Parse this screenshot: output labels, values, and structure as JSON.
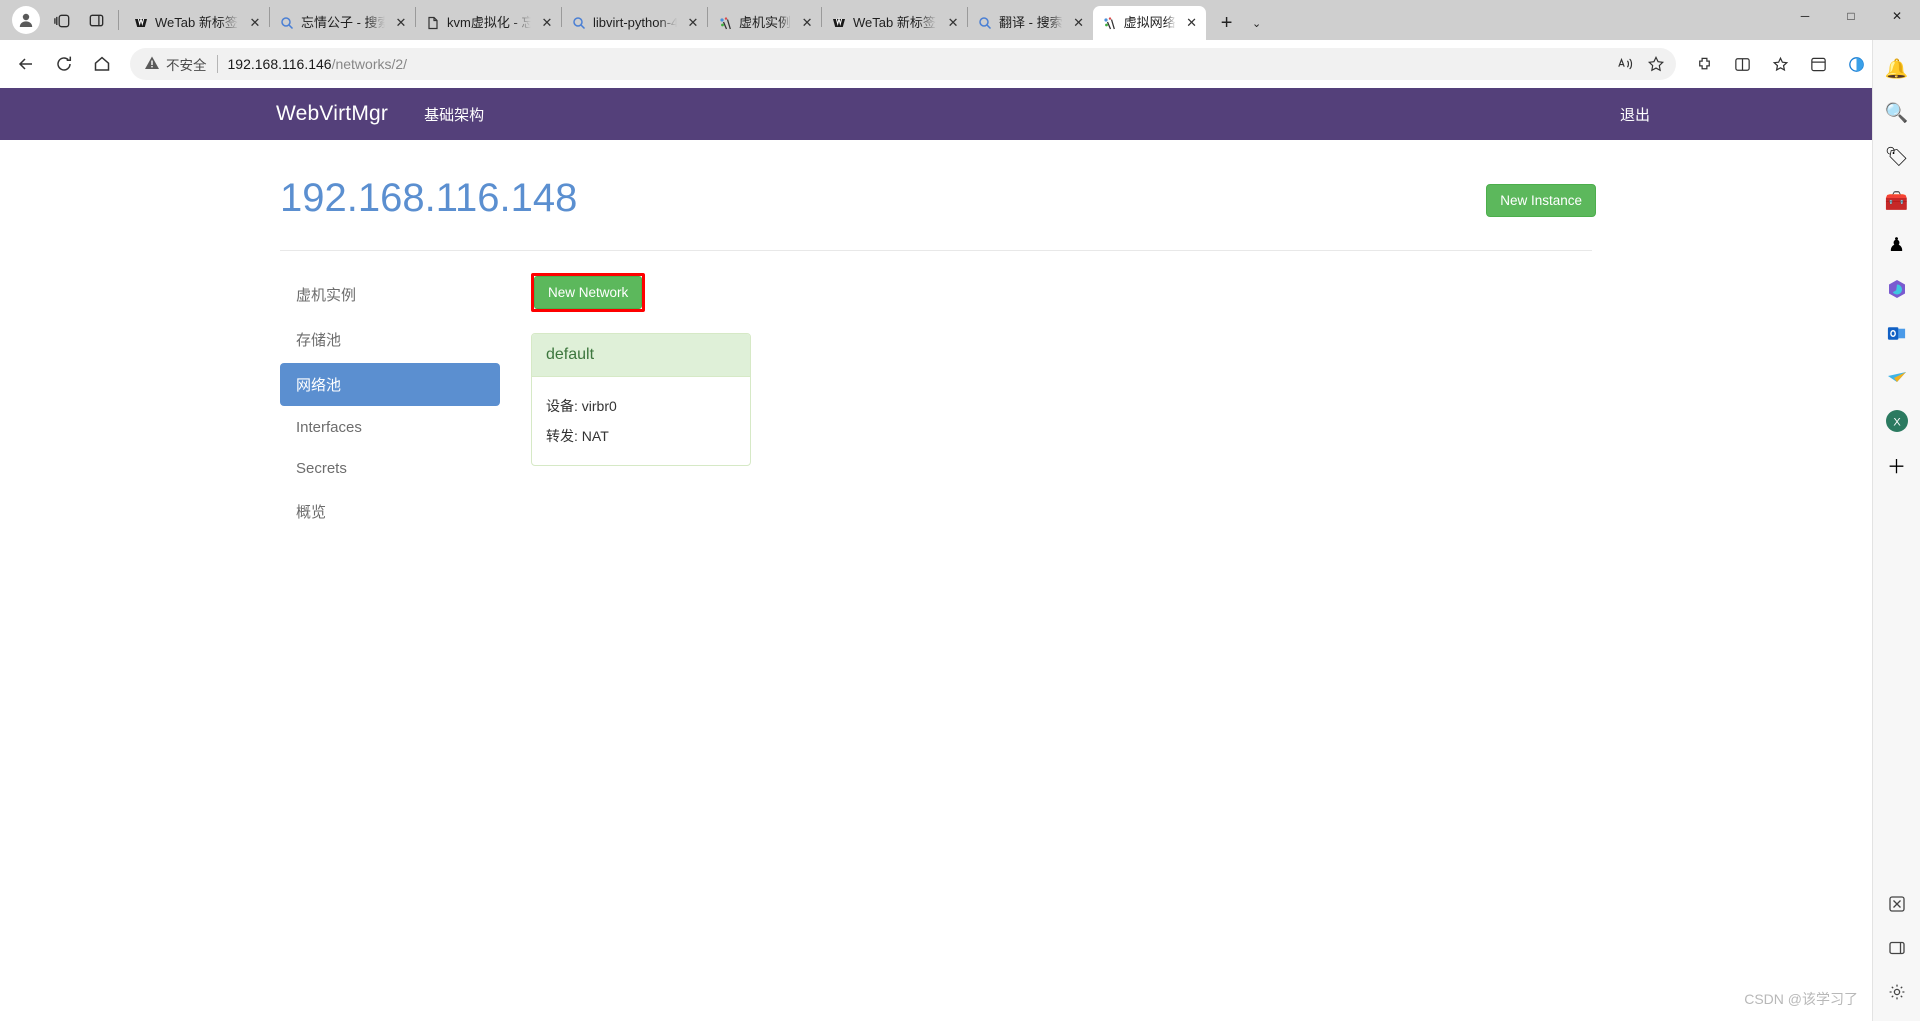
{
  "browser": {
    "toolbar_icons": [
      {
        "name": "profile-avatar-icon",
        "glyph": "●"
      },
      {
        "name": "workspaces-icon",
        "glyph": "❐"
      },
      {
        "name": "tab-actions-icon",
        "glyph": "▭"
      }
    ],
    "tabs": [
      {
        "title": "WeTab 新标签页",
        "favicon": "wetab-icon",
        "active": false
      },
      {
        "title": "忘情公子 - 搜索",
        "favicon": "search-icon",
        "active": false
      },
      {
        "title": "kvm虚拟化 - 忘",
        "favicon": "document-icon",
        "active": false
      },
      {
        "title": "libvirt-python-4",
        "favicon": "search-icon",
        "active": false
      },
      {
        "title": "虚机实例",
        "favicon": "webvirtmgr-icon",
        "active": false
      },
      {
        "title": "WeTab 新标签页",
        "favicon": "wetab-icon",
        "active": false
      },
      {
        "title": "翻译 - 搜索",
        "favicon": "search-icon",
        "active": false
      },
      {
        "title": "虚拟网络",
        "favicon": "webvirtmgr-icon",
        "active": true
      }
    ],
    "tab_close_label": "✕",
    "new_tab_label": "+",
    "tab_list_label": "⌄",
    "window_controls": [
      {
        "name": "minimize-button",
        "glyph": "─"
      },
      {
        "name": "maximize-button",
        "glyph": "□"
      },
      {
        "name": "close-window-button",
        "glyph": "✕"
      }
    ],
    "nav": {
      "back_label": "←",
      "reload_label": "↻",
      "home_label": "⌂",
      "security_warning": "不安全",
      "warning_icon": "warning-triangle-icon",
      "url_host": "192.168.116.146",
      "url_path": "/networks/2/",
      "read_aloud_label": "Aᴰ",
      "favorite_label": "☆",
      "right_icons": [
        {
          "name": "extensions-icon",
          "glyph": "⚙"
        },
        {
          "name": "split-screen-icon",
          "glyph": "◫"
        },
        {
          "name": "collections-icon",
          "glyph": "☆"
        },
        {
          "name": "favorites-bar-icon",
          "glyph": "❐"
        },
        {
          "name": "browser-essentials-icon",
          "glyph": "◑"
        },
        {
          "name": "settings-more-icon",
          "glyph": "⋯"
        }
      ]
    },
    "edge_sidebar_icons": [
      {
        "name": "notifications-bell-icon",
        "glyph": "🔔"
      },
      {
        "name": "search-icon",
        "glyph": "🔍"
      },
      {
        "name": "shopping-tag-icon",
        "glyph": "🏷"
      },
      {
        "name": "tools-briefcase-icon",
        "glyph": "🧰"
      },
      {
        "name": "games-icon",
        "glyph": "♟"
      },
      {
        "name": "microsoft-365-icon",
        "glyph": "⬢"
      },
      {
        "name": "outlook-icon",
        "glyph": "Ⓞ"
      },
      {
        "name": "shopping-cart-icon",
        "glyph": "➤"
      },
      {
        "name": "excel-icon",
        "glyph": "X"
      },
      {
        "name": "add-sidebar-app-icon",
        "glyph": "＋"
      },
      {
        "name": "customize-sidebar-icon",
        "glyph": "❖"
      },
      {
        "name": "sidebar-toggle-icon",
        "glyph": "▭"
      },
      {
        "name": "sidebar-settings-icon",
        "glyph": "⚙"
      }
    ]
  },
  "page": {
    "navbar": {
      "brand": "WebVirtMgr",
      "links": [
        "基础架构"
      ],
      "logout_label": "退出",
      "background_color": "#54407a"
    },
    "header": {
      "title": "192.168.116.148",
      "title_color": "#5b8fd0",
      "new_instance_label": "New Instance",
      "new_instance_color": "#5cb85c"
    },
    "side_nav": {
      "items": [
        {
          "label": "虚机实例",
          "active": false
        },
        {
          "label": "存储池",
          "active": false
        },
        {
          "label": "网络池",
          "active": true
        },
        {
          "label": "Interfaces",
          "active": false
        },
        {
          "label": "Secrets",
          "active": false
        },
        {
          "label": "概览",
          "active": false
        }
      ],
      "active_color": "#5b8fd0"
    },
    "content": {
      "new_network_label": "New Network",
      "new_network_color": "#5cb85c",
      "highlight_color": "#fe0000",
      "networks": [
        {
          "name": "default",
          "rows": [
            {
              "label": "设备:",
              "value": "virbr0"
            },
            {
              "label": "转发:",
              "value": "NAT"
            }
          ]
        }
      ]
    },
    "watermark": "CSDN @该学习了"
  }
}
